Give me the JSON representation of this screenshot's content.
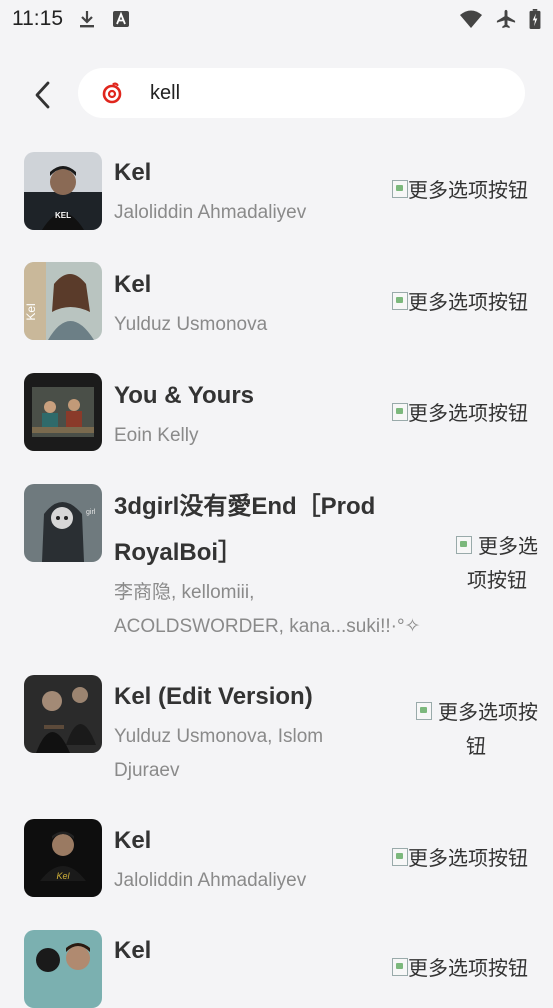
{
  "status_bar": {
    "time": "11:15",
    "left_icons": [
      "download-icon",
      "font-a-icon"
    ],
    "right_icons": [
      "wifi-icon",
      "airplane-icon",
      "battery-icon"
    ]
  },
  "search": {
    "query": "kell",
    "logo": "netease-music-logo"
  },
  "more_label": "更多选项按钮",
  "songs": [
    {
      "title": "Kel",
      "artist": "Jaloliddin Ahmadaliyev"
    },
    {
      "title": "Kel",
      "artist": "Yulduz Usmonova"
    },
    {
      "title": "You & Yours",
      "artist": "Eoin Kelly"
    },
    {
      "title": "3dgirl没有愛End［Prod",
      "title2": "RoyalBoi］",
      "artist": "李商隐, kellomiii,",
      "artist2": "ACOLDSWORDER, kana...suki!!·°✧"
    },
    {
      "title": "Kel (Edit Version)",
      "artist": "Yulduz Usmonova, Islom",
      "artist2": "Djuraev"
    },
    {
      "title": "Kel",
      "artist": "Jaloliddin Ahmadaliyev"
    },
    {
      "title": "Kel",
      "artist": ""
    }
  ],
  "more_wrapped": {
    "line1": "更多选",
    "line2": "项按钮",
    "line1b": "更多选项按",
    "line2b": "钮"
  },
  "colors": {
    "background": "#f4f4f6",
    "title": "#333333",
    "artist": "#8a8a8a",
    "brand_red": "#e0261d"
  }
}
